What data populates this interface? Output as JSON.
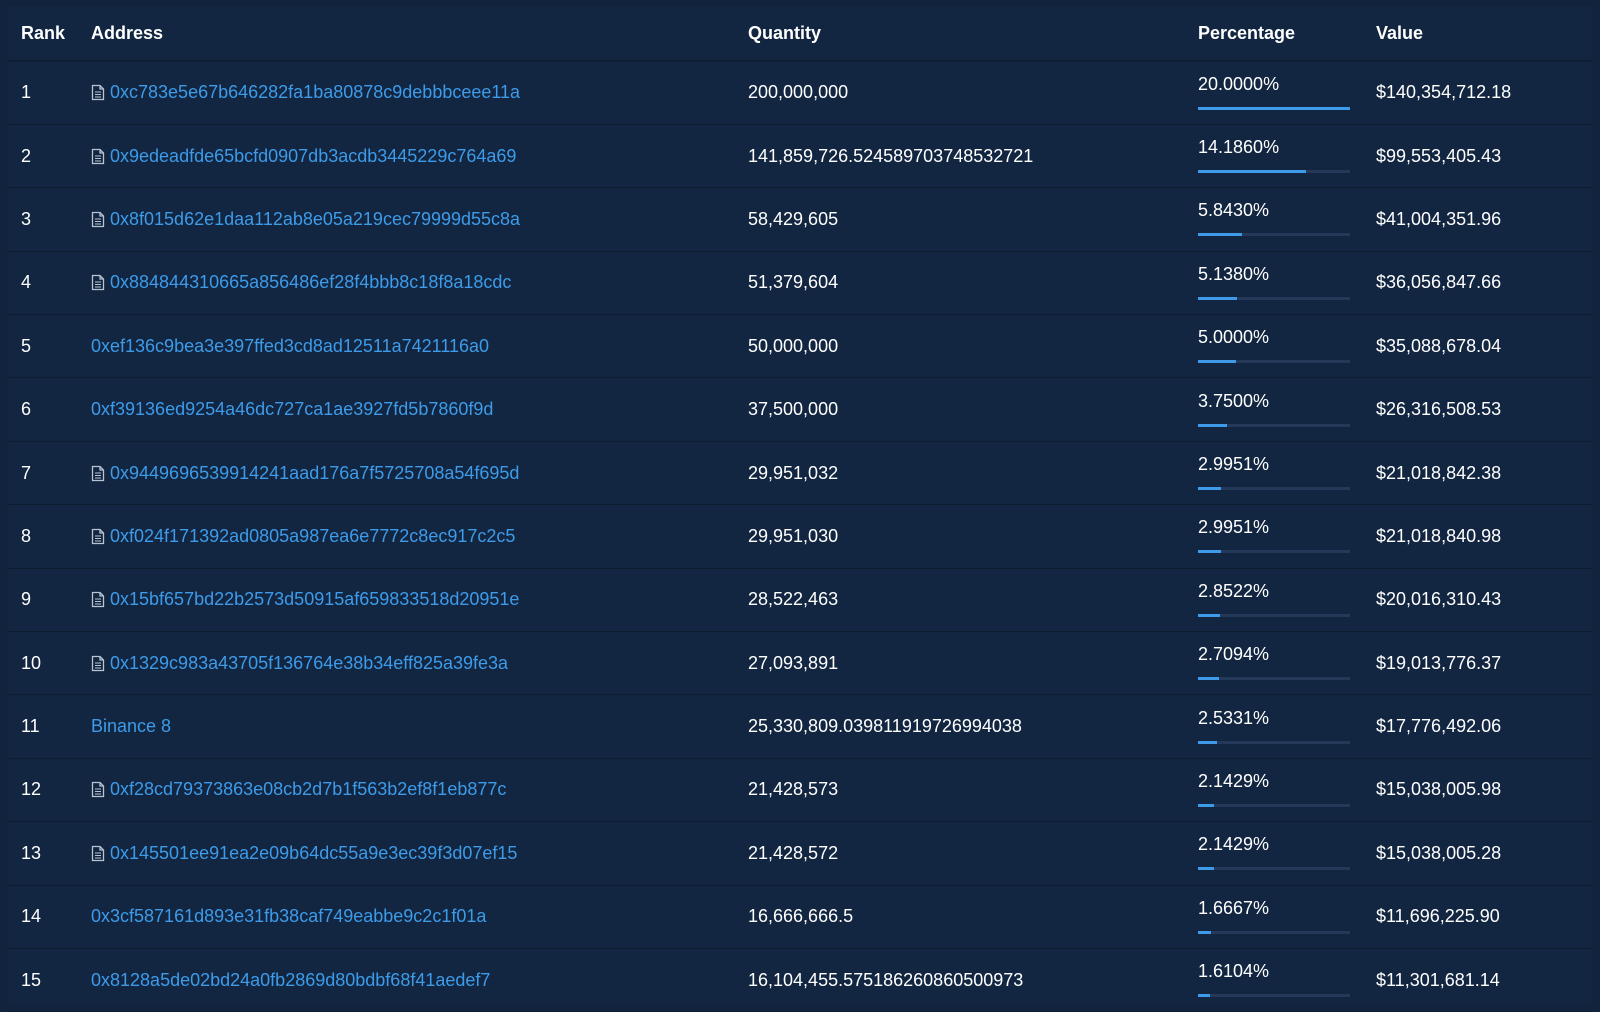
{
  "columns": {
    "rank": "Rank",
    "address": "Address",
    "quantity": "Quantity",
    "percentage": "Percentage",
    "value": "Value"
  },
  "colors": {
    "background": "#122641",
    "link": "#3d9be9",
    "bar_fill": "#3d9be9",
    "bar_track": "#24385a"
  },
  "rows": [
    {
      "rank": "1",
      "address": "0xc783e5e67b646282fa1ba80878c9debbbceee11a",
      "contract": true,
      "quantity": "200,000,000",
      "percentage": "20.0000%",
      "share": 1.0,
      "value": "$140,354,712.18"
    },
    {
      "rank": "2",
      "address": "0x9edeadfde65bcfd0907db3acdb3445229c764a69",
      "contract": true,
      "quantity": "141,859,726.524589703748532721",
      "percentage": "14.1860%",
      "share": 0.7093,
      "value": "$99,553,405.43"
    },
    {
      "rank": "3",
      "address": "0x8f015d62e1daa112ab8e05a219cec79999d55c8a",
      "contract": true,
      "quantity": "58,429,605",
      "percentage": "5.8430%",
      "share": 0.2922,
      "value": "$41,004,351.96"
    },
    {
      "rank": "4",
      "address": "0x884844310665a856486ef28f4bbb8c18f8a18cdc",
      "contract": true,
      "quantity": "51,379,604",
      "percentage": "5.1380%",
      "share": 0.2569,
      "value": "$36,056,847.66"
    },
    {
      "rank": "5",
      "address": "0xef136c9bea3e397ffed3cd8ad12511a7421116a0",
      "contract": false,
      "quantity": "50,000,000",
      "percentage": "5.0000%",
      "share": 0.25,
      "value": "$35,088,678.04"
    },
    {
      "rank": "6",
      "address": "0xf39136ed9254a46dc727ca1ae3927fd5b7860f9d",
      "contract": false,
      "quantity": "37,500,000",
      "percentage": "3.7500%",
      "share": 0.1875,
      "value": "$26,316,508.53"
    },
    {
      "rank": "7",
      "address": "0x9449696539914241aad176a7f5725708a54f695d",
      "contract": true,
      "quantity": "29,951,032",
      "percentage": "2.9951%",
      "share": 0.1498,
      "value": "$21,018,842.38"
    },
    {
      "rank": "8",
      "address": "0xf024f171392ad0805a987ea6e7772c8ec917c2c5",
      "contract": true,
      "quantity": "29,951,030",
      "percentage": "2.9951%",
      "share": 0.1498,
      "value": "$21,018,840.98"
    },
    {
      "rank": "9",
      "address": "0x15bf657bd22b2573d50915af659833518d20951e",
      "contract": true,
      "quantity": "28,522,463",
      "percentage": "2.8522%",
      "share": 0.1426,
      "value": "$20,016,310.43"
    },
    {
      "rank": "10",
      "address": "0x1329c983a43705f136764e38b34eff825a39fe3a",
      "contract": true,
      "quantity": "27,093,891",
      "percentage": "2.7094%",
      "share": 0.1355,
      "value": "$19,013,776.37"
    },
    {
      "rank": "11",
      "address": "Binance 8",
      "contract": false,
      "quantity": "25,330,809.039811919726994038",
      "percentage": "2.5331%",
      "share": 0.1267,
      "value": "$17,776,492.06"
    },
    {
      "rank": "12",
      "address": "0xf28cd79373863e08cb2d7b1f563b2ef8f1eb877c",
      "contract": true,
      "quantity": "21,428,573",
      "percentage": "2.1429%",
      "share": 0.1071,
      "value": "$15,038,005.98"
    },
    {
      "rank": "13",
      "address": "0x145501ee91ea2e09b64dc55a9e3ec39f3d07ef15",
      "contract": true,
      "quantity": "21,428,572",
      "percentage": "2.1429%",
      "share": 0.1071,
      "value": "$15,038,005.28"
    },
    {
      "rank": "14",
      "address": "0x3cf587161d893e31fb38caf749eabbe9c2c1f01a",
      "contract": false,
      "quantity": "16,666,666.5",
      "percentage": "1.6667%",
      "share": 0.0833,
      "value": "$11,696,225.90"
    },
    {
      "rank": "15",
      "address": "0x8128a5de02bd24a0fb2869d80bdbf68f41aedef7",
      "contract": false,
      "quantity": "16,104,455.575186260860500973",
      "percentage": "1.6104%",
      "share": 0.0805,
      "value": "$11,301,681.14"
    }
  ]
}
